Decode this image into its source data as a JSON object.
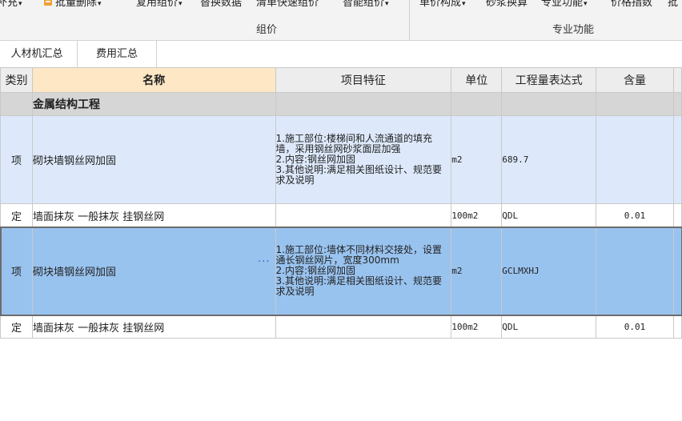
{
  "ribbon": {
    "items": [
      {
        "label": "补充",
        "caret": "▾"
      },
      {
        "label": "批量删除",
        "caret": "▾"
      },
      {
        "label": "复用组价",
        "caret": "▾"
      },
      {
        "label": "替换数据",
        "caret": ""
      },
      {
        "label": "清单快速组价",
        "caret": ""
      },
      {
        "label": "智能组价",
        "caret": "▾"
      },
      {
        "label": "单价构成",
        "caret": "▾"
      },
      {
        "label": "砂浆换算",
        "caret": ""
      },
      {
        "label": "专业功能",
        "caret": "▾"
      },
      {
        "label": "价格指数",
        "caret": ""
      },
      {
        "label": "批",
        "caret": ""
      }
    ],
    "groups": [
      "组价",
      "专业功能"
    ]
  },
  "tabs": [
    "人材机汇总",
    "费用汇总"
  ],
  "grid": {
    "columns": [
      "类别",
      "名称",
      "项目特征",
      "单位",
      "工程量表达式",
      "含量"
    ],
    "rows": [
      {
        "kind": "section",
        "type": "",
        "name": "金属结构工程",
        "feature": "",
        "unit": "",
        "expr": "",
        "qty": ""
      },
      {
        "kind": "qd",
        "type": "项",
        "name": "砌块墙钢丝网加固",
        "feature": "1.施工部位:楼梯间和人流通道的填充墙，采用钢丝网砂浆面层加强\n2.内容:钢丝网加固\n3.其他说明:满足相关图纸设计、规范要求及说明",
        "unit": "m2",
        "expr": "689.7",
        "qty": ""
      },
      {
        "kind": "de",
        "type": "定",
        "name": "墙面抹灰 一般抹灰 挂钢丝网",
        "feature": "",
        "unit": "100m2",
        "expr": "QDL",
        "qty": "0.01"
      },
      {
        "kind": "qd",
        "type": "项",
        "name": "砌块墙钢丝网加固",
        "feature": "1.施工部位:墙体不同材料交接处，设置通长钢丝网片，宽度300mm\n2.内容:钢丝网加固\n3.其他说明:满足相关图纸设计、规范要求及说明",
        "unit": "m2",
        "expr": "GCLMXHJ",
        "qty": "",
        "selected": true,
        "ellipsis": "···"
      },
      {
        "kind": "de",
        "type": "定",
        "name": "墙面抹灰 一般抹灰 挂钢丝网",
        "feature": "",
        "unit": "100m2",
        "expr": "QDL",
        "qty": "0.01"
      }
    ]
  }
}
